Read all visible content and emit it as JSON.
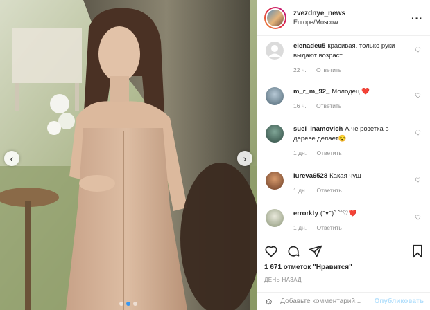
{
  "post": {
    "username": "zvezdnye_news",
    "location": "Europe/Moscow"
  },
  "comments": [
    {
      "user": "elenadeu5",
      "text": "красивая. только руки выдают возраст",
      "time": "22 ч.",
      "reply": "Ответить",
      "avatar": "default"
    },
    {
      "user": "m_r_m_92_",
      "text": "Молодец ❤️",
      "time": "16 ч.",
      "reply": "Ответить",
      "avatar": "photo"
    },
    {
      "user": "suel_inamovich",
      "text": "А че розетка в дереве делает😵",
      "time": "1 дн.",
      "reply": "Ответить",
      "avatar": "photo"
    },
    {
      "user": "iureva6528",
      "text": "Какая чуш",
      "time": "1 дн.",
      "reply": "Ответить",
      "avatar": "photo"
    },
    {
      "user": "errorkty",
      "text": "(ᵔᴥᵔ)ˆ ˆ°♡❤️",
      "time": "1 дн.",
      "reply": "Ответить",
      "avatar": "photo"
    }
  ],
  "likes": "1 671 отметок \"Нравится\"",
  "time_ago": "ДЕНЬ НАЗАД",
  "add_comment": {
    "placeholder": "Добавьте комментарий...",
    "post_label": "Опубликовать"
  },
  "carousel": {
    "total": 3,
    "active": 1
  },
  "colors": {
    "accent": "#3897f0",
    "like_red": "#ed4956",
    "post_disabled": "#b2dffc"
  },
  "icons": [
    "heart-icon",
    "comment-icon",
    "share-icon",
    "bookmark-icon",
    "emoji-icon",
    "more-icon",
    "chevron-left-icon",
    "chevron-right-icon"
  ]
}
